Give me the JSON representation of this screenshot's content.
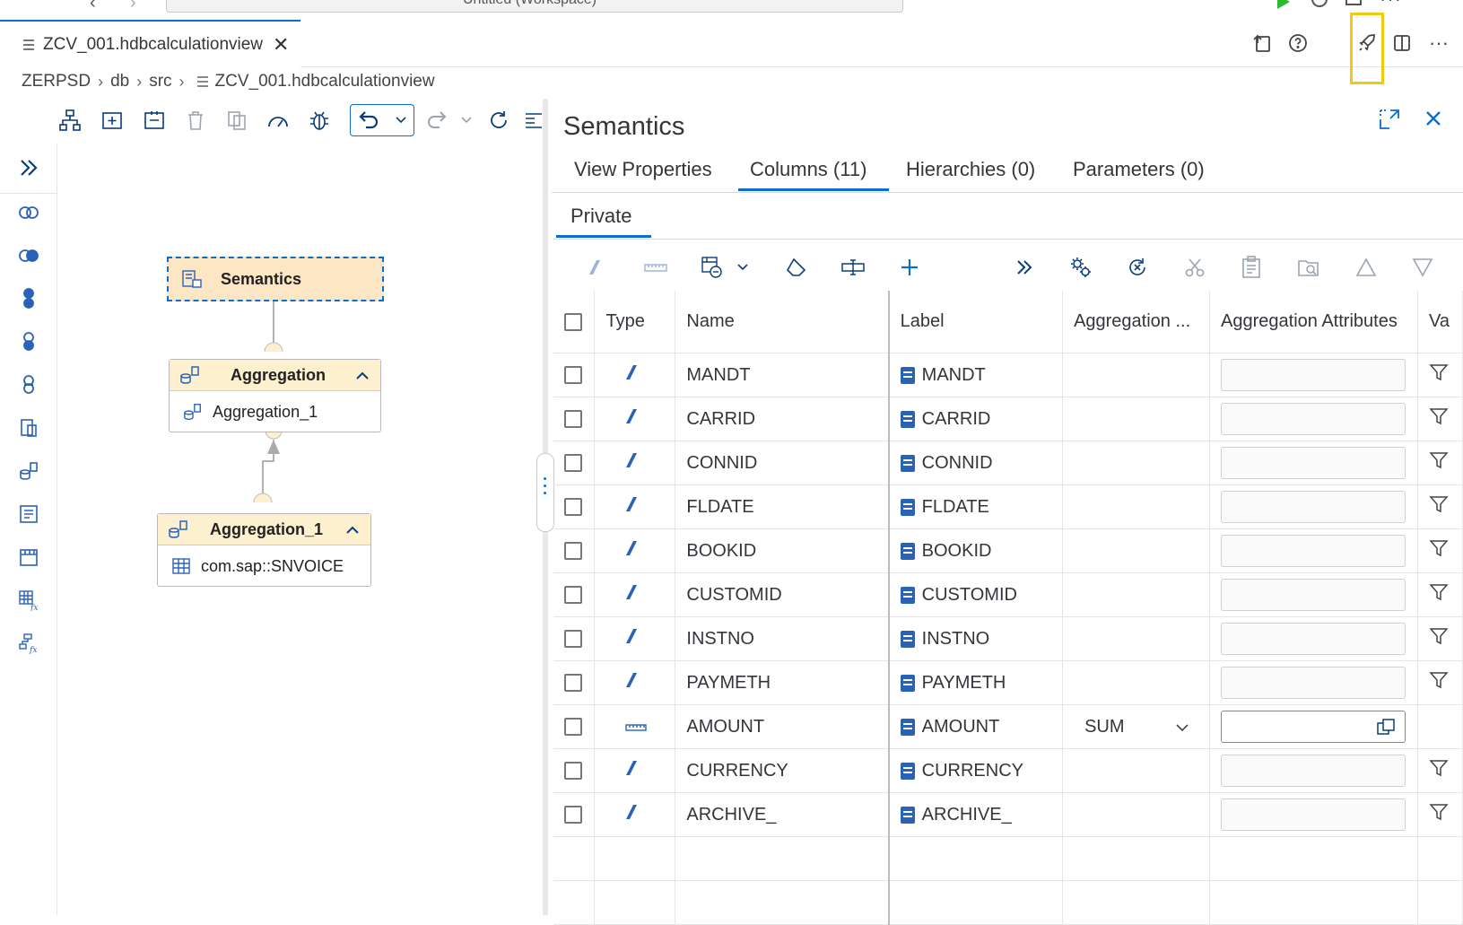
{
  "workspace_title": "Untitled (Workspace)",
  "editor_tab": {
    "title": "ZCV_001.hdbcalculationview",
    "close": "✕"
  },
  "breadcrumb": [
    "ZERPSD",
    "db",
    "src",
    "ZCV_001.hdbcalculationview"
  ],
  "canvas": {
    "semantics_node": "Semantics",
    "aggregation_node": {
      "title": "Aggregation",
      "child": "Aggregation_1"
    },
    "aggregation_1_node": {
      "title": "Aggregation_1",
      "child": "com.sap::SNVOICE"
    }
  },
  "panel": {
    "title": "Semantics",
    "tabs": [
      "View Properties",
      "Columns (11)",
      "Hierarchies (0)",
      "Parameters (0)"
    ],
    "active_tab": "Columns (11)",
    "subtab": "Private",
    "columns": [
      "Type",
      "Name",
      "Label",
      "Aggregation ...",
      "Aggregation Attributes",
      "Va"
    ],
    "rows": [
      {
        "type": "attribute",
        "name": "MANDT",
        "label": "MANDT",
        "aggregation": ""
      },
      {
        "type": "attribute",
        "name": "CARRID",
        "label": "CARRID",
        "aggregation": ""
      },
      {
        "type": "attribute",
        "name": "CONNID",
        "label": "CONNID",
        "aggregation": ""
      },
      {
        "type": "attribute",
        "name": "FLDATE",
        "label": "FLDATE",
        "aggregation": ""
      },
      {
        "type": "attribute",
        "name": "BOOKID",
        "label": "BOOKID",
        "aggregation": ""
      },
      {
        "type": "attribute",
        "name": "CUSTOMID",
        "label": "CUSTOMID",
        "aggregation": ""
      },
      {
        "type": "attribute",
        "name": "INSTNO",
        "label": "INSTNO",
        "aggregation": ""
      },
      {
        "type": "attribute",
        "name": "PAYMETH",
        "label": "PAYMETH",
        "aggregation": ""
      },
      {
        "type": "measure",
        "name": "AMOUNT",
        "label": "AMOUNT",
        "aggregation": "SUM"
      },
      {
        "type": "attribute",
        "name": "CURRENCY",
        "label": "CURRENCY",
        "aggregation": ""
      },
      {
        "type": "attribute",
        "name": "ARCHIVE_",
        "label": "ARCHIVE_",
        "aggregation": ""
      }
    ]
  },
  "colors": {
    "accent": "#0a6ed1",
    "highlight": "#f2c811",
    "node_header": "#fdf0cf",
    "attribute_icon": "#2a62b8",
    "run": "#2eb82e"
  }
}
